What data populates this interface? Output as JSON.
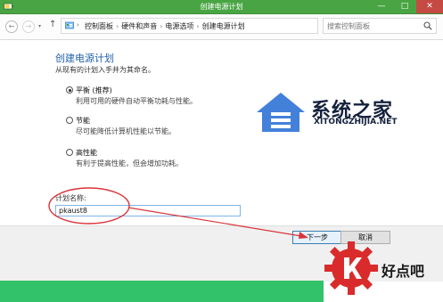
{
  "window": {
    "title": "创建电源计划",
    "min_label": "—",
    "max_label": "□",
    "close_label": "✕"
  },
  "nav": {
    "back_glyph": "←",
    "forward_glyph": "→",
    "history_glyph": "▾",
    "up_glyph": "↑"
  },
  "address": {
    "crumbs": [
      "控制面板",
      "硬件和声音",
      "电源选项",
      "创建电源计划"
    ],
    "separator": "›",
    "dropdown_glyph": "▾",
    "refresh_glyph": "↻"
  },
  "search": {
    "placeholder": "搜索控制面板"
  },
  "main": {
    "title": "创建电源计划",
    "subtitle": "从现有的计划入手并为其命名。",
    "options": [
      {
        "label": "平衡 (推荐)",
        "desc": "利用可用的硬件自动平衡功耗与性能。",
        "checked": true
      },
      {
        "label": "节能",
        "desc": "尽可能降低计算机性能以节能。",
        "checked": false
      },
      {
        "label": "高性能",
        "desc": "有利于提高性能，但会增加功耗。",
        "checked": false
      }
    ],
    "plan_name_label": "计划名称:",
    "plan_name_value": "pkaust8"
  },
  "buttons": {
    "next": "下一步",
    "cancel": "取消"
  },
  "watermarks": {
    "site_cn": "系统之家",
    "site_en": "XITONGZHIJIA.NET",
    "brand": "好点吧"
  },
  "colors": {
    "title_bar": "#49a543",
    "accent_blue": "#1f5fa8",
    "annotation_red": "#d9333a",
    "green_strip": "#32c26a"
  },
  "icons": {
    "app": "power-options-icon",
    "address": "control-panel-icon",
    "search": "search-icon"
  }
}
